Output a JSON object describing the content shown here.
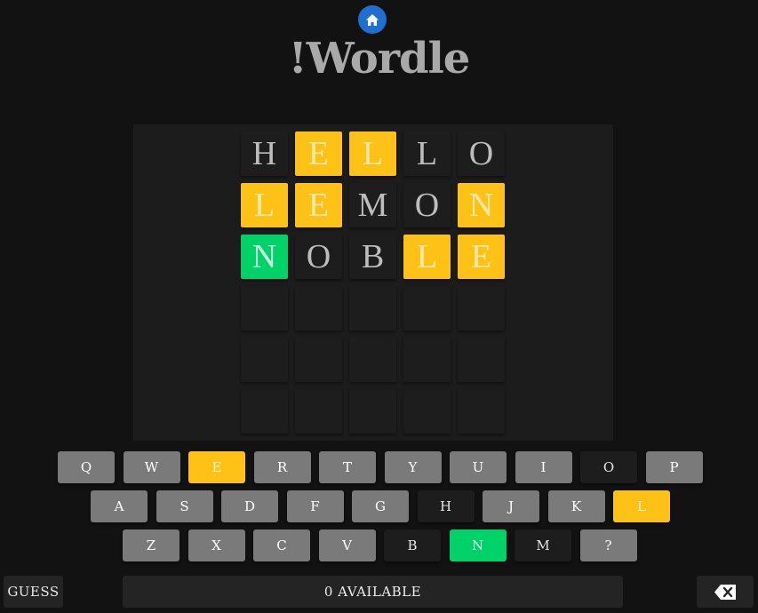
{
  "header": {
    "home_icon": "home-icon",
    "title": "!Wordle",
    "accent_color": "#1e6fd0"
  },
  "colors": {
    "present": "#fec115",
    "correct": "#00d26a",
    "absent": "#1d1d1d",
    "unused": "#7a7a7a"
  },
  "board": {
    "rows": [
      [
        {
          "letter": "H",
          "state": "absent"
        },
        {
          "letter": "E",
          "state": "present"
        },
        {
          "letter": "L",
          "state": "present"
        },
        {
          "letter": "L",
          "state": "absent"
        },
        {
          "letter": "O",
          "state": "absent"
        }
      ],
      [
        {
          "letter": "L",
          "state": "present"
        },
        {
          "letter": "E",
          "state": "present"
        },
        {
          "letter": "M",
          "state": "absent"
        },
        {
          "letter": "O",
          "state": "absent"
        },
        {
          "letter": "N",
          "state": "present"
        }
      ],
      [
        {
          "letter": "N",
          "state": "correct"
        },
        {
          "letter": "O",
          "state": "absent"
        },
        {
          "letter": "B",
          "state": "absent"
        },
        {
          "letter": "L",
          "state": "present"
        },
        {
          "letter": "E",
          "state": "present"
        }
      ],
      [
        {
          "letter": "",
          "state": "empty"
        },
        {
          "letter": "",
          "state": "empty"
        },
        {
          "letter": "",
          "state": "empty"
        },
        {
          "letter": "",
          "state": "empty"
        },
        {
          "letter": "",
          "state": "empty"
        }
      ],
      [
        {
          "letter": "",
          "state": "empty"
        },
        {
          "letter": "",
          "state": "empty"
        },
        {
          "letter": "",
          "state": "empty"
        },
        {
          "letter": "",
          "state": "empty"
        },
        {
          "letter": "",
          "state": "empty"
        }
      ],
      [
        {
          "letter": "",
          "state": "empty"
        },
        {
          "letter": "",
          "state": "empty"
        },
        {
          "letter": "",
          "state": "empty"
        },
        {
          "letter": "",
          "state": "empty"
        },
        {
          "letter": "",
          "state": "empty"
        }
      ]
    ]
  },
  "keyboard": {
    "rows": [
      [
        {
          "label": "Q",
          "state": "unused"
        },
        {
          "label": "W",
          "state": "unused"
        },
        {
          "label": "E",
          "state": "present"
        },
        {
          "label": "R",
          "state": "unused"
        },
        {
          "label": "T",
          "state": "unused"
        },
        {
          "label": "Y",
          "state": "unused"
        },
        {
          "label": "U",
          "state": "unused"
        },
        {
          "label": "I",
          "state": "unused"
        },
        {
          "label": "O",
          "state": "absent"
        },
        {
          "label": "P",
          "state": "unused"
        }
      ],
      [
        {
          "label": "A",
          "state": "unused"
        },
        {
          "label": "S",
          "state": "unused"
        },
        {
          "label": "D",
          "state": "unused"
        },
        {
          "label": "F",
          "state": "unused"
        },
        {
          "label": "G",
          "state": "unused"
        },
        {
          "label": "H",
          "state": "absent"
        },
        {
          "label": "J",
          "state": "unused"
        },
        {
          "label": "K",
          "state": "unused"
        },
        {
          "label": "L",
          "state": "present"
        }
      ],
      [
        {
          "label": "Z",
          "state": "unused"
        },
        {
          "label": "X",
          "state": "unused"
        },
        {
          "label": "C",
          "state": "unused"
        },
        {
          "label": "V",
          "state": "unused"
        },
        {
          "label": "B",
          "state": "absent"
        },
        {
          "label": "N",
          "state": "correct"
        },
        {
          "label": "M",
          "state": "absent"
        },
        {
          "label": "?",
          "state": "unused"
        }
      ]
    ]
  },
  "footer": {
    "guess_label": "GUESS",
    "available_text": "0 AVAILABLE",
    "backspace_icon": "backspace-icon"
  }
}
